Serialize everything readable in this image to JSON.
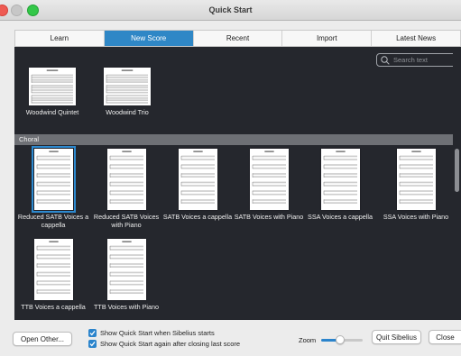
{
  "window": {
    "title": "Quick Start"
  },
  "tabs": [
    {
      "label": "Learn",
      "active": false
    },
    {
      "label": "New Score",
      "active": true
    },
    {
      "label": "Recent",
      "active": false
    },
    {
      "label": "Import",
      "active": false
    },
    {
      "label": "Latest News",
      "active": false
    }
  ],
  "search": {
    "placeholder": "Search text",
    "value": ""
  },
  "top_templates": [
    {
      "label": "Woodwind Quintet"
    },
    {
      "label": "Woodwind Trio"
    }
  ],
  "category": {
    "name": "Choral",
    "templates": [
      {
        "label": "Reduced SATB Voices a cappella",
        "selected": true
      },
      {
        "label": "Reduced SATB Voices with Piano",
        "selected": false
      },
      {
        "label": "SATB Voices a cappella",
        "selected": false
      },
      {
        "label": "SATB Voices with Piano",
        "selected": false
      },
      {
        "label": "SSA Voices a cappella",
        "selected": false
      },
      {
        "label": "SSA Voices with Piano",
        "selected": false
      },
      {
        "label": "TTB Voices a cappella",
        "selected": false
      },
      {
        "label": "TTB Voices with Piano",
        "selected": false
      }
    ]
  },
  "footer": {
    "open_other": "Open Other...",
    "show_on_start": "Show Quick Start when Sibelius starts",
    "show_on_start_checked": true,
    "show_after_close": "Show Quick Start again after closing last score",
    "show_after_close_checked": true,
    "zoom_label": "Zoom",
    "zoom_level": 0.45,
    "quit": "Quit Sibelius",
    "close": "Close"
  },
  "colors": {
    "accent": "#2f87c6",
    "gallery_background": "#25272d",
    "category_header": "#6e7075"
  },
  "icons": {
    "search": "search-icon",
    "checkbox": "checkmark-icon"
  }
}
